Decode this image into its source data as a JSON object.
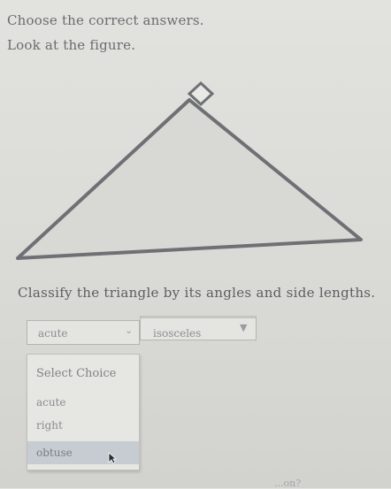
{
  "instructions": {
    "line1": "Choose the correct answers.",
    "line2": "Look at the figure."
  },
  "figure": {
    "stroke_color": "#6e7074",
    "fill_color": "#d8d8d4"
  },
  "question": {
    "text": "Classify the triangle by its angles and side lengths."
  },
  "angle_select": {
    "value": "acute",
    "chevron": "chevron-down-icon"
  },
  "side_select": {
    "value": "isosceles",
    "chevron": "chevron-down-icon"
  },
  "dropdown": {
    "options": [
      {
        "label": "Select Choice"
      },
      {
        "label": "acute"
      },
      {
        "label": "right"
      },
      {
        "label": "obtuse"
      }
    ],
    "highlighted": "obtuse",
    "highlight_color": "#c6ccd2"
  },
  "bottom_fragment": "...on?"
}
